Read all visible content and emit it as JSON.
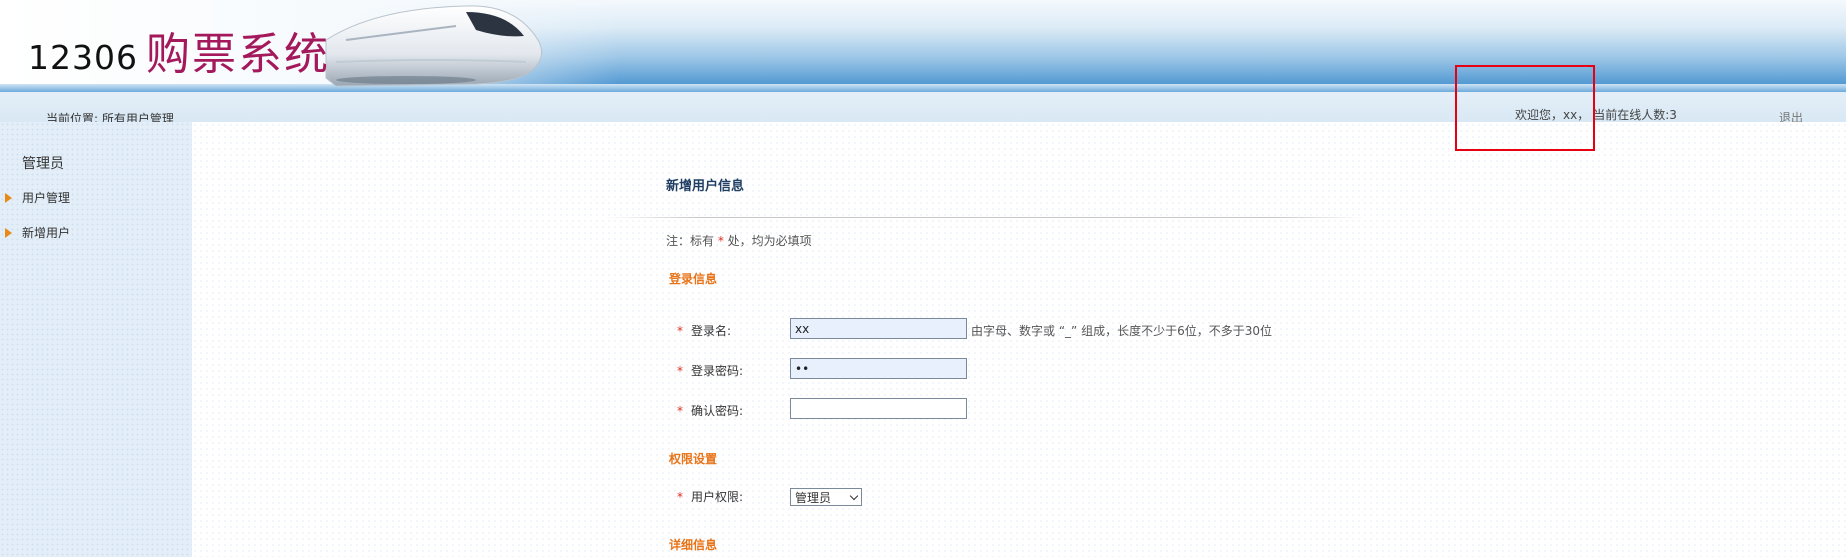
{
  "header": {
    "logo_number": "12306",
    "logo_text": "购票系统"
  },
  "statusbar": {
    "breadcrumb": "当前位置: 所有用户管理",
    "welcome": "欢迎您，xx，",
    "online": "当前在线人数:3",
    "logout": "退出"
  },
  "sidebar": {
    "title": "管理员",
    "items": [
      {
        "label": "用户管理",
        "icon": "triangle-right-icon"
      },
      {
        "label": "新增用户",
        "icon": "triangle-right-icon"
      }
    ]
  },
  "form": {
    "title": "新增用户信息",
    "note_prefix": "注：标有",
    "note_star": "*",
    "note_suffix": "处，均为必填项",
    "sections": {
      "login": "登录信息",
      "permission": "权限设置",
      "detail": "详细信息"
    },
    "required_mark": "*",
    "fields": {
      "username": {
        "label": "登录名:",
        "value": "xx"
      },
      "password": {
        "label": "登录密码:",
        "value": "••"
      },
      "confirm": {
        "label": "确认密码:",
        "value": ""
      },
      "permission": {
        "label": "用户权限:",
        "value": "管理员"
      }
    },
    "username_hint": "由字母、数字或 “_” 组成，长度不少于6位，不多于30位"
  },
  "colors": {
    "logo": "#a3195b",
    "section": "#e8741a",
    "required": "#e0301e",
    "annotation": "#e60012"
  }
}
